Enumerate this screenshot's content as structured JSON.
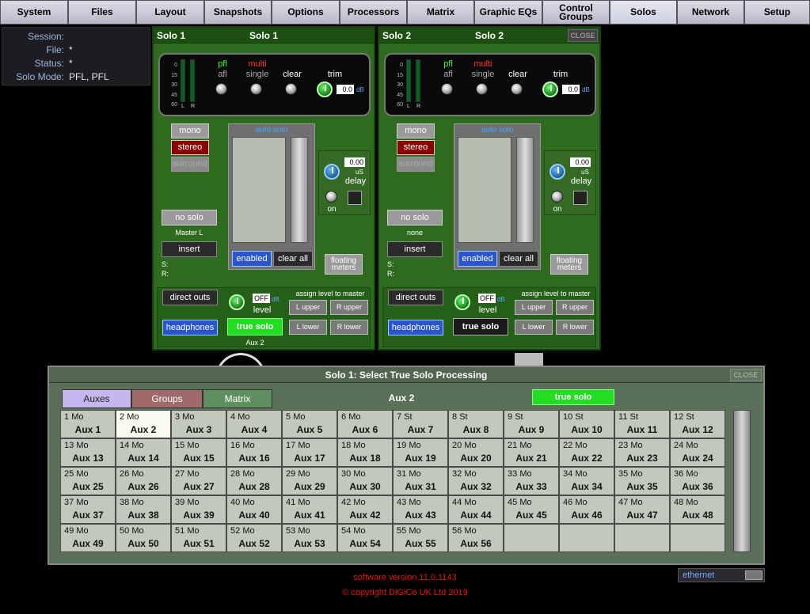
{
  "nav": {
    "tabs": [
      "System",
      "Files",
      "Layout",
      "Snapshots",
      "Options",
      "Processors",
      "Matrix",
      "Graphic EQs",
      "Control\nGroups",
      "Solos",
      "Network",
      "Setup"
    ],
    "active": "Solos"
  },
  "session": {
    "session_label": "Session:",
    "session_value": "",
    "file_label": "File:",
    "file_value": "*",
    "status_label": "Status:",
    "status_value": "*",
    "mode_label": "Solo Mode:",
    "mode_value": "PFL, PFL"
  },
  "panels": [
    {
      "left_label": "Solo 1",
      "title": "Solo 1",
      "close": "",
      "meter_scale": [
        "0",
        "15",
        "30",
        "45",
        "60"
      ],
      "meter_l": "L",
      "meter_r": "R",
      "pfl": "pfl",
      "afl": "afl",
      "multi": "multi",
      "single": "single",
      "clear": "clear",
      "trim": "trim",
      "trim_value": "0.0",
      "trim_unit": "dB",
      "mono": "mono",
      "stereo": "stereo",
      "surround": "surround",
      "auto_solo": "auto solo",
      "delay_value": "0.00",
      "delay_unit": "uS",
      "delay": "delay",
      "on": "on",
      "no_solo": "no solo",
      "dest": "Master L",
      "insert": "insert",
      "s_label": "S:",
      "r_label": "R:",
      "enabled": "enabled",
      "clear_all": "clear all",
      "floating": "floating\nmeters",
      "direct_outs": "direct outs",
      "level_value": "OFF",
      "level_unit": "dB",
      "level": "level",
      "assign": "assign level to master",
      "l_upper": "L upper",
      "r_upper": "R upper",
      "l_lower": "L lower",
      "r_lower": "R lower",
      "headphones": "headphones",
      "true_solo": "true solo",
      "true_solo_dest": "Aux 2"
    },
    {
      "left_label": "Solo 2",
      "title": "Solo 2",
      "close": "CLOSE",
      "meter_scale": [
        "0",
        "15",
        "30",
        "45",
        "60"
      ],
      "meter_l": "L",
      "meter_r": "R",
      "pfl": "pfl",
      "afl": "afl",
      "multi": "multi",
      "single": "single",
      "clear": "clear",
      "trim": "trim",
      "trim_value": "0.0",
      "trim_unit": "dB",
      "mono": "mono",
      "stereo": "stereo",
      "surround": "surround",
      "auto_solo": "auto solo",
      "delay_value": "0.00",
      "delay_unit": "uS",
      "delay": "delay",
      "on": "on",
      "no_solo": "no solo",
      "dest": "none",
      "insert": "insert",
      "s_label": "S:",
      "r_label": "R:",
      "enabled": "enabled",
      "clear_all": "clear all",
      "floating": "floating\nmeters",
      "direct_outs": "direct outs",
      "level_value": "OFF",
      "level_unit": "dB",
      "level": "level",
      "assign": "assign level to master",
      "l_upper": "L upper",
      "r_upper": "R upper",
      "l_lower": "L lower",
      "r_lower": "R lower",
      "headphones": "headphones",
      "true_solo": "true solo",
      "true_solo_dest": ""
    }
  ],
  "dialog": {
    "title": "Solo 1: Select True Solo Processing",
    "close": "CLOSE",
    "tabs": [
      "Auxes",
      "Groups",
      "Matrix"
    ],
    "selected_name": "Aux 2",
    "true_solo": "true solo",
    "auxes": [
      {
        "n": "1",
        "t": "Mo",
        "name": "Aux 1"
      },
      {
        "n": "2",
        "t": "Mo",
        "name": "Aux 2"
      },
      {
        "n": "3",
        "t": "Mo",
        "name": "Aux 3"
      },
      {
        "n": "4",
        "t": "Mo",
        "name": "Aux 4"
      },
      {
        "n": "5",
        "t": "Mo",
        "name": "Aux 5"
      },
      {
        "n": "6",
        "t": "Mo",
        "name": "Aux 6"
      },
      {
        "n": "7",
        "t": "St",
        "name": "Aux 7"
      },
      {
        "n": "8",
        "t": "St",
        "name": "Aux 8"
      },
      {
        "n": "9",
        "t": "St",
        "name": "Aux 9"
      },
      {
        "n": "10",
        "t": "St",
        "name": "Aux 10"
      },
      {
        "n": "11",
        "t": "St",
        "name": "Aux 11"
      },
      {
        "n": "12",
        "t": "St",
        "name": "Aux 12"
      },
      {
        "n": "13",
        "t": "Mo",
        "name": "Aux 13"
      },
      {
        "n": "14",
        "t": "Mo",
        "name": "Aux 14"
      },
      {
        "n": "15",
        "t": "Mo",
        "name": "Aux 15"
      },
      {
        "n": "16",
        "t": "Mo",
        "name": "Aux 16"
      },
      {
        "n": "17",
        "t": "Mo",
        "name": "Aux 17"
      },
      {
        "n": "18",
        "t": "Mo",
        "name": "Aux 18"
      },
      {
        "n": "19",
        "t": "Mo",
        "name": "Aux 19"
      },
      {
        "n": "20",
        "t": "Mo",
        "name": "Aux 20"
      },
      {
        "n": "21",
        "t": "Mo",
        "name": "Aux 21"
      },
      {
        "n": "22",
        "t": "Mo",
        "name": "Aux 22"
      },
      {
        "n": "23",
        "t": "Mo",
        "name": "Aux 23"
      },
      {
        "n": "24",
        "t": "Mo",
        "name": "Aux 24"
      },
      {
        "n": "25",
        "t": "Mo",
        "name": "Aux 25"
      },
      {
        "n": "26",
        "t": "Mo",
        "name": "Aux 26"
      },
      {
        "n": "27",
        "t": "Mo",
        "name": "Aux 27"
      },
      {
        "n": "28",
        "t": "Mo",
        "name": "Aux 28"
      },
      {
        "n": "29",
        "t": "Mo",
        "name": "Aux 29"
      },
      {
        "n": "30",
        "t": "Mo",
        "name": "Aux 30"
      },
      {
        "n": "31",
        "t": "Mo",
        "name": "Aux 31"
      },
      {
        "n": "32",
        "t": "Mo",
        "name": "Aux 32"
      },
      {
        "n": "33",
        "t": "Mo",
        "name": "Aux 33"
      },
      {
        "n": "34",
        "t": "Mo",
        "name": "Aux 34"
      },
      {
        "n": "35",
        "t": "Mo",
        "name": "Aux 35"
      },
      {
        "n": "36",
        "t": "Mo",
        "name": "Aux 36"
      },
      {
        "n": "37",
        "t": "Mo",
        "name": "Aux 37"
      },
      {
        "n": "38",
        "t": "Mo",
        "name": "Aux 38"
      },
      {
        "n": "39",
        "t": "Mo",
        "name": "Aux 39"
      },
      {
        "n": "40",
        "t": "Mo",
        "name": "Aux 40"
      },
      {
        "n": "41",
        "t": "Mo",
        "name": "Aux 41"
      },
      {
        "n": "42",
        "t": "Mo",
        "name": "Aux 42"
      },
      {
        "n": "43",
        "t": "Mo",
        "name": "Aux 43"
      },
      {
        "n": "44",
        "t": "Mo",
        "name": "Aux 44"
      },
      {
        "n": "45",
        "t": "Mo",
        "name": "Aux 45"
      },
      {
        "n": "46",
        "t": "Mo",
        "name": "Aux 46"
      },
      {
        "n": "47",
        "t": "Mo",
        "name": "Aux 47"
      },
      {
        "n": "48",
        "t": "Mo",
        "name": "Aux 48"
      },
      {
        "n": "49",
        "t": "Mo",
        "name": "Aux 49"
      },
      {
        "n": "50",
        "t": "Mo",
        "name": "Aux 50"
      },
      {
        "n": "51",
        "t": "Mo",
        "name": "Aux 51"
      },
      {
        "n": "52",
        "t": "Mo",
        "name": "Aux 52"
      },
      {
        "n": "53",
        "t": "Mo",
        "name": "Aux 53"
      },
      {
        "n": "54",
        "t": "Mo",
        "name": "Aux 54"
      },
      {
        "n": "55",
        "t": "Mo",
        "name": "Aux 55"
      },
      {
        "n": "56",
        "t": "Mo",
        "name": "Aux 56"
      }
    ],
    "selected_index": 1
  },
  "footer": {
    "version": "software version 11.0.1143",
    "copyright": "© copyright DiGiCo UK Ltd 2019",
    "ethernet": "ethernet"
  },
  "colors": {
    "panel_green": "#2e6b1e",
    "dialog_bg": "#5a7058",
    "true_solo_green": "#22dd22",
    "accent_red": "#dd1111"
  }
}
